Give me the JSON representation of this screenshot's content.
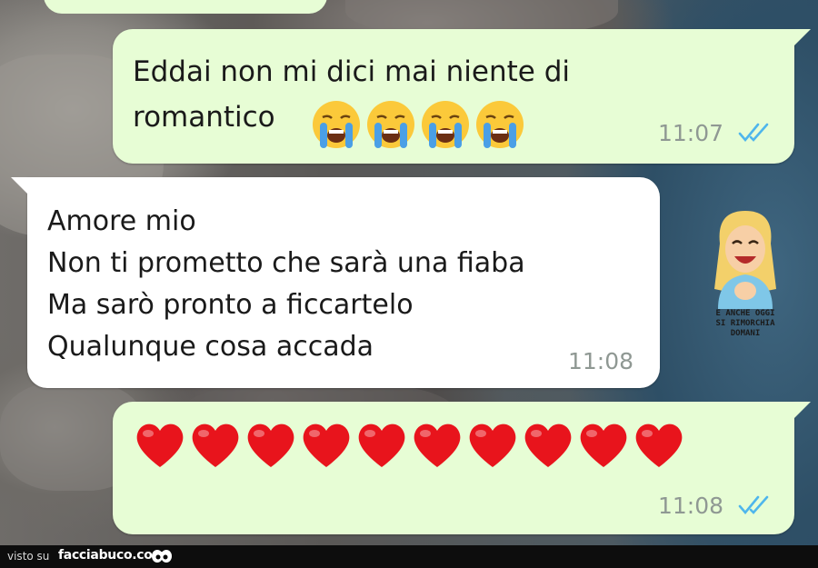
{
  "messages": [
    {
      "direction": "outgoing",
      "text": "Eddai non mi dici mai niente di\nromantico",
      "emoji": [
        "loudly-crying-face",
        "loudly-crying-face",
        "loudly-crying-face",
        "loudly-crying-face"
      ],
      "time": "11:07",
      "status": "read-double-check"
    },
    {
      "direction": "incoming",
      "text": "Amore mio\nNon ti prometto che sarà una fiaba\nMa sarò pronto a ficcartelo\nQualunque cosa accada",
      "time": "11:08"
    },
    {
      "direction": "outgoing",
      "emoji": [
        "red-heart",
        "red-heart",
        "red-heart",
        "red-heart",
        "red-heart",
        "red-heart",
        "red-heart",
        "red-heart",
        "red-heart",
        "red-heart"
      ],
      "time": "11:08",
      "status": "read-double-check"
    }
  ],
  "sticker": {
    "caption": "E ANCHE OGGI\nSI RIMORCHIA DOMANI",
    "icon": "laughing-woman-sticker"
  },
  "footer": {
    "visto": "visto su",
    "site": "facciabuco.com",
    "icon": "eyes-logo-icon"
  },
  "colors": {
    "outgoing_bubble": "#e7fdd5",
    "incoming_bubble": "#ffffff",
    "read_tick": "#4fb6ec",
    "time_text": "#8f9893",
    "heart": "#e8141c"
  }
}
